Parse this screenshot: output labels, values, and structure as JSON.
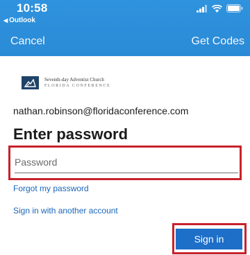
{
  "status_bar": {
    "time": "10:58",
    "back_app_label": "Outlook"
  },
  "nav": {
    "cancel_label": "Cancel",
    "get_codes_label": "Get Codes"
  },
  "org": {
    "name_line1": "Seventh-day Adventist Church",
    "name_line2": "FLORIDA CONFERENCE"
  },
  "account": {
    "email": "nathan.robinson@floridaconference.com"
  },
  "form": {
    "heading": "Enter password",
    "password_placeholder": "Password",
    "forgot_link": "Forgot my password",
    "other_account_link": "Sign in with another account",
    "sign_in_label": "Sign in"
  },
  "colors": {
    "header_blue": "#2f93de",
    "link_blue": "#1a66b8",
    "button_blue": "#1d6fc8",
    "highlight_red": "#c8212b"
  },
  "icons": [
    "signal-icon",
    "wifi-icon",
    "battery-icon",
    "back-triangle-icon"
  ]
}
